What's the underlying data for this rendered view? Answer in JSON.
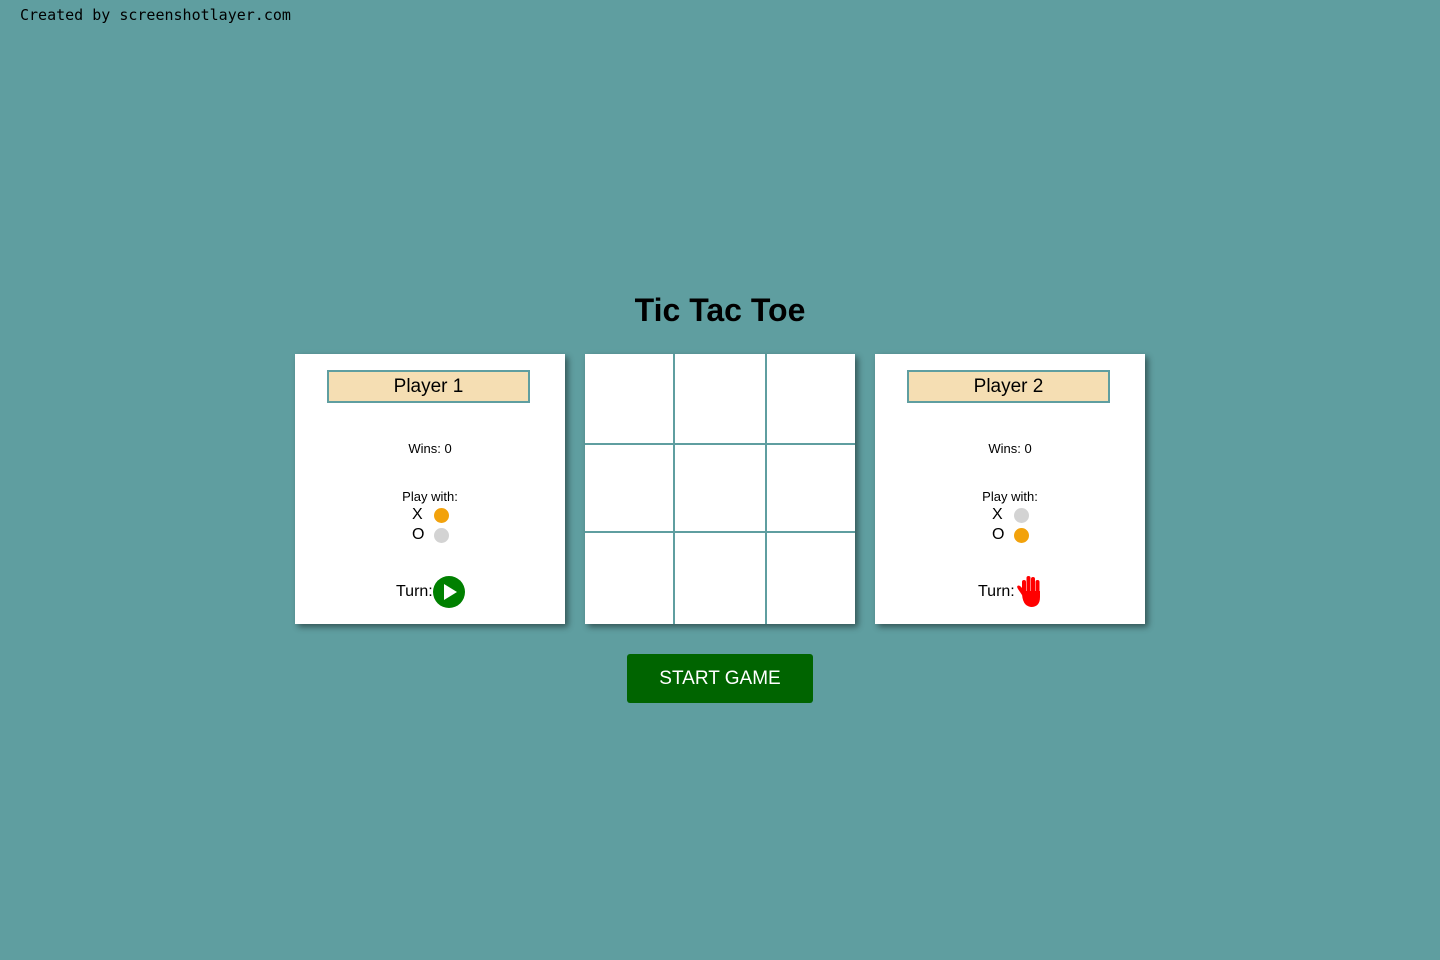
{
  "credit": "Created by screenshotlayer.com",
  "title": "Tic Tac Toe",
  "players": [
    {
      "name": "Player 1",
      "wins_text": "Wins: 0",
      "play_with_label": "Play with:",
      "x_label": "X",
      "o_label": "O",
      "selected_symbol": "X",
      "turn_label": "Turn:",
      "turn_icon": "play-circle-icon",
      "turn_icon_color": "#008000"
    },
    {
      "name": "Player 2",
      "wins_text": "Wins: 0",
      "play_with_label": "Play with:",
      "x_label": "X",
      "o_label": "O",
      "selected_symbol": "O",
      "turn_label": "Turn:",
      "turn_icon": "stop-hand-icon",
      "turn_icon_color": "#ff0000"
    }
  ],
  "board": {
    "cells": [
      "",
      "",
      "",
      "",
      "",
      "",
      "",
      "",
      ""
    ]
  },
  "start_button_label": "START GAME",
  "colors": {
    "background": "#5f9ea0",
    "name_field": "#f5deb3",
    "radio_selected": "#f2a20c",
    "radio_unselected": "#d3d3d3",
    "start_button": "#006400"
  }
}
